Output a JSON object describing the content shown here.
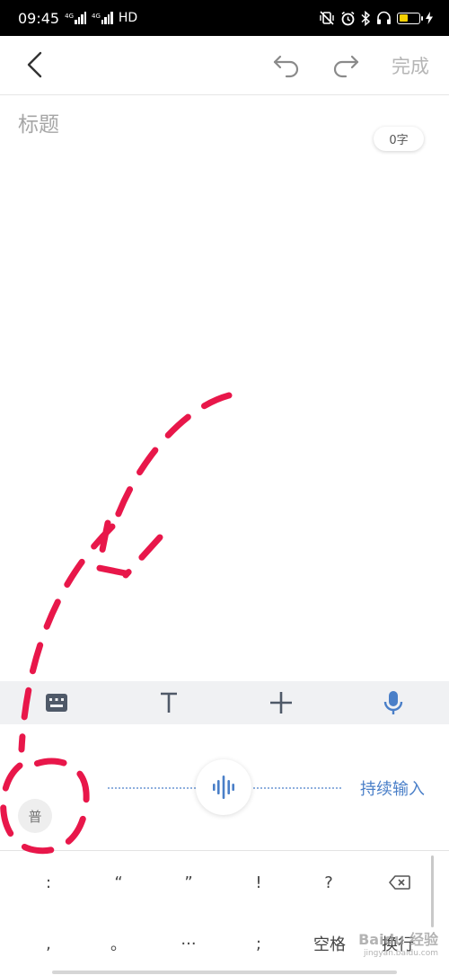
{
  "status_bar": {
    "time": "09:45",
    "network_1": "4G",
    "network_2": "4G",
    "hd_label": "HD",
    "icons": [
      "mute-vibrate-icon",
      "alarm-icon",
      "bluetooth-icon",
      "headphones-icon",
      "battery-icon",
      "charging-icon"
    ],
    "battery_level": 0.45,
    "battery_color": "#f5d000"
  },
  "toolbar": {
    "back_icon": "chevron-left-icon",
    "undo_icon": "undo-icon",
    "redo_icon": "redo-icon",
    "done_label": "完成"
  },
  "editor": {
    "title_placeholder": "标题",
    "title_value": "",
    "word_count": "0字"
  },
  "format_bar": {
    "buttons": [
      {
        "name": "keyboard",
        "icon": "keyboard-icon"
      },
      {
        "name": "text-format",
        "icon": "text-format-icon"
      },
      {
        "name": "insert",
        "icon": "plus-icon"
      },
      {
        "name": "voice",
        "icon": "microphone-icon",
        "active": true
      }
    ],
    "accent_color": "#4a7fc8"
  },
  "voice_panel": {
    "mode_badge": "普",
    "continuous_label": "持续输入"
  },
  "keyboard": {
    "row1": [
      ":",
      "“",
      "”",
      "!",
      "?"
    ],
    "row2": [
      ",",
      "。",
      "···",
      ";"
    ],
    "space_label": "空格",
    "enter_label": "换行",
    "backspace_icon": "backspace-icon"
  },
  "watermark": {
    "logo": "Baidu 经验",
    "url": "jingyan.baidu.com"
  },
  "annotation_color": "#e8174a"
}
